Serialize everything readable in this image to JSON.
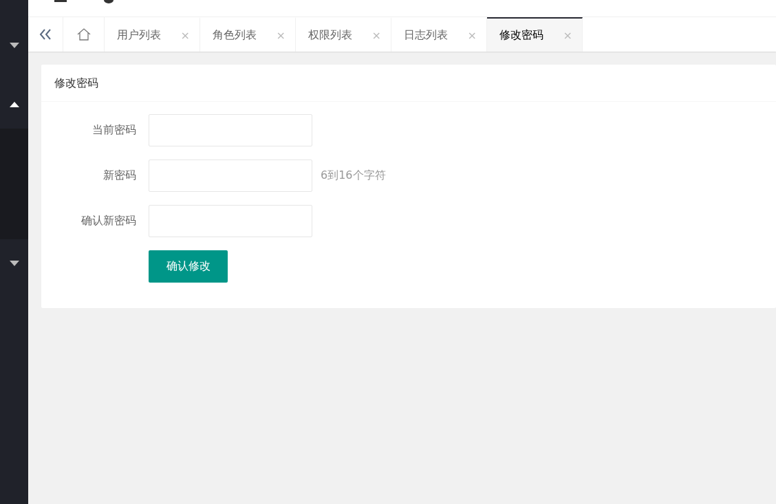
{
  "sidebar": {
    "items": [
      {
        "expanded": false
      },
      {
        "expanded": true
      },
      {
        "expanded": false
      }
    ]
  },
  "tabs": {
    "items": [
      {
        "kind": "back"
      },
      {
        "kind": "home"
      },
      {
        "kind": "page",
        "label": "用户列表",
        "close": "×",
        "selected": false
      },
      {
        "kind": "page",
        "label": "角色列表",
        "close": "×",
        "selected": false
      },
      {
        "kind": "page",
        "label": "权限列表",
        "close": "×",
        "selected": false
      },
      {
        "kind": "page",
        "label": "日志列表",
        "close": "×",
        "selected": false
      },
      {
        "kind": "page",
        "label": "修改密码",
        "close": "×",
        "selected": true
      }
    ]
  },
  "card": {
    "title": "修改密码",
    "fields": [
      {
        "label": "当前密码"
      },
      {
        "label": "新密码",
        "hint": "6到16个字符"
      },
      {
        "label": "确认新密码"
      }
    ],
    "submit": "确认修改"
  }
}
